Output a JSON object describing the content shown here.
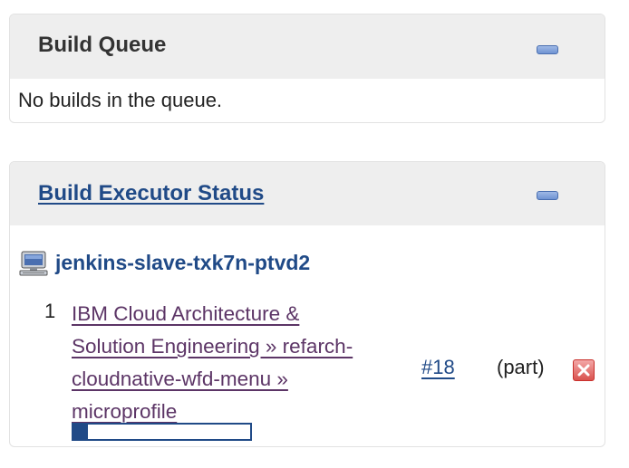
{
  "build_queue": {
    "title": "Build Queue",
    "empty_message": "No builds in the queue."
  },
  "executor_status": {
    "title": "Build Executor Status",
    "node": {
      "name": "jenkins-slave-txk7n-ptvd2",
      "icon": "computer-icon"
    },
    "executors": [
      {
        "number": "1",
        "job_line_1": "IBM Cloud Architecture &",
        "job_line_2": "Solution Engineering » refarch-",
        "job_line_3": "cloudnative-wfd-menu »",
        "job_line_4": "microprofile",
        "build": "#18",
        "build_note": "(part)",
        "progress_percent": 8,
        "stop_icon": "stop-icon"
      }
    ]
  },
  "colors": {
    "link": "#204a87",
    "visited_link": "#5c3566",
    "header_bg": "#eeeeee"
  }
}
